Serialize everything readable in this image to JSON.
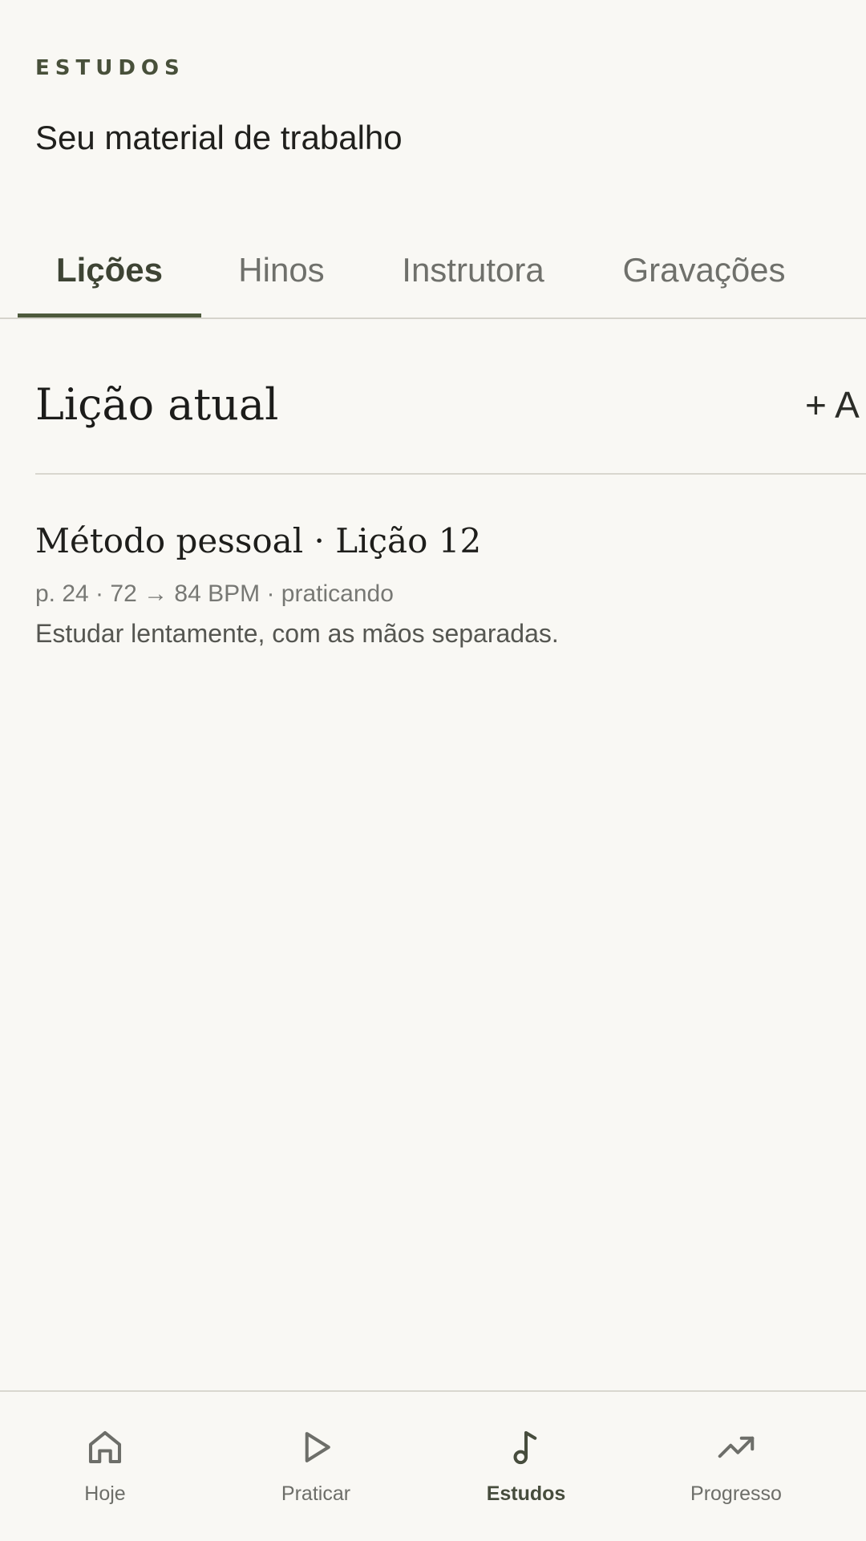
{
  "header": {
    "eyebrow": "ESTUDOS",
    "subtitle": "Seu material de trabalho"
  },
  "tabs": [
    {
      "label": "Lições",
      "active": true
    },
    {
      "label": "Hinos",
      "active": false
    },
    {
      "label": "Instrutora",
      "active": false
    },
    {
      "label": "Gravações",
      "active": false
    }
  ],
  "section": {
    "title": "Lição atual",
    "add_label": "+ A"
  },
  "lesson": {
    "title": "Método pessoal · Lição 12",
    "meta": "p. 24 · 72 → 84 BPM · praticando",
    "note": "Estudar lentamente, com as mãos separadas."
  },
  "bottom_nav": [
    {
      "label": "Hoje",
      "icon": "home-icon",
      "active": false
    },
    {
      "label": "Praticar",
      "icon": "play-icon",
      "active": false
    },
    {
      "label": "Estudos",
      "icon": "music-note-icon",
      "active": true
    },
    {
      "label": "Progresso",
      "icon": "trending-up-icon",
      "active": false
    }
  ],
  "colors": {
    "background": "#f9f8f4",
    "accent": "#4e5a3c",
    "muted_text": "#6f706b"
  }
}
